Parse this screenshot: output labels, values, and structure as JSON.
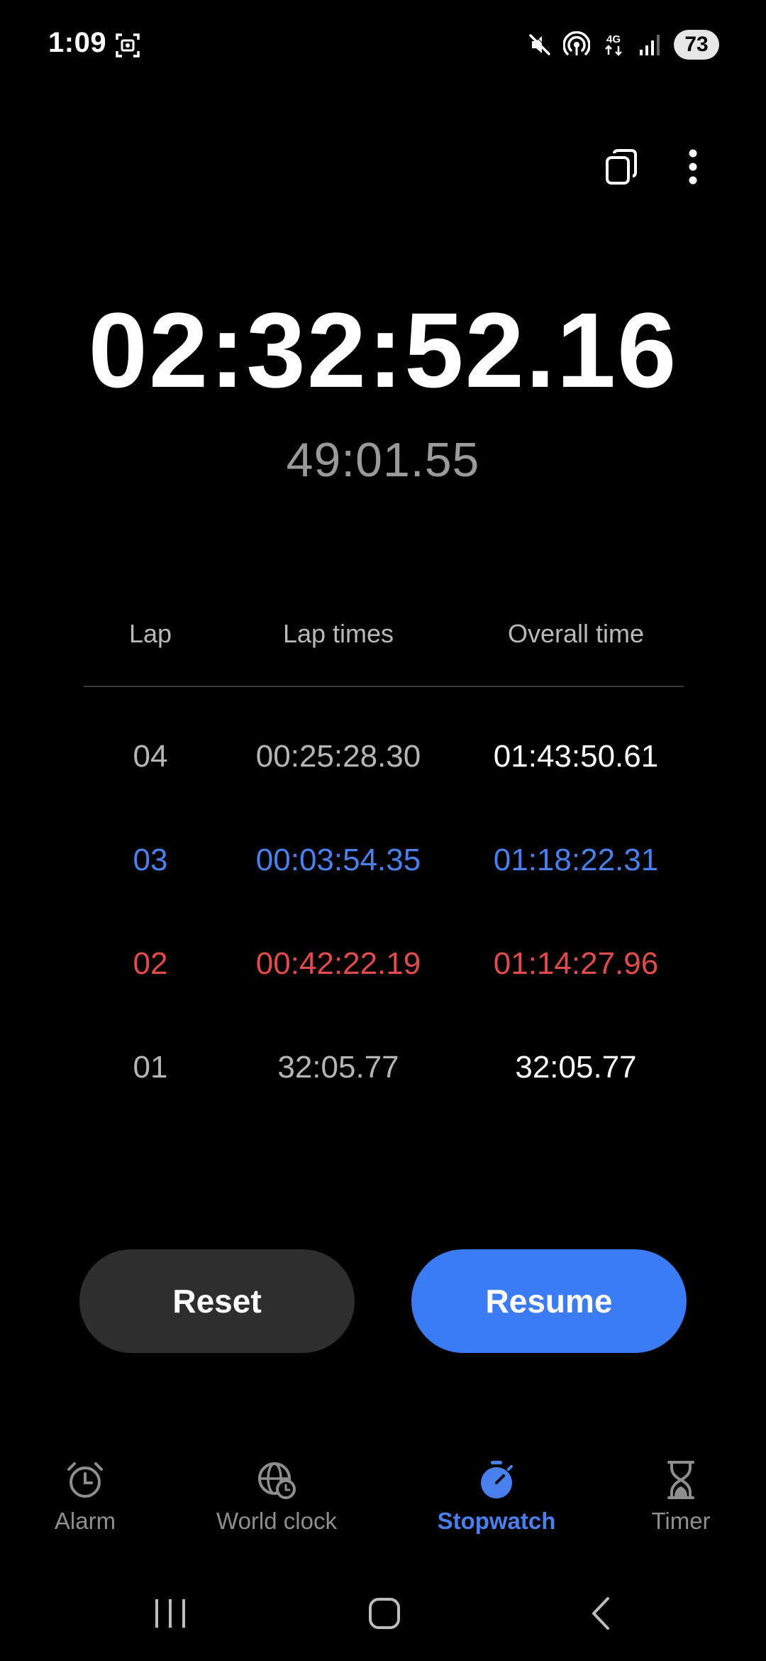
{
  "status_bar": {
    "time": "1:09",
    "battery_level": "73",
    "network_label": "4G"
  },
  "toolbar": {
    "pip_icon": "picture-in-picture-icon",
    "more_icon": "more-vert-icon"
  },
  "stopwatch": {
    "main_time": "02:32:52.16",
    "current_lap_time": "49:01.55"
  },
  "laps": {
    "headers": {
      "lap": "Lap",
      "lap_times": "Lap times",
      "overall_time": "Overall time"
    },
    "rows": [
      {
        "lap": "04",
        "lap_time": "00:25:28.30",
        "overall": "01:43:50.61",
        "status": "normal"
      },
      {
        "lap": "03",
        "lap_time": "00:03:54.35",
        "overall": "01:18:22.31",
        "status": "fastest"
      },
      {
        "lap": "02",
        "lap_time": "00:42:22.19",
        "overall": "01:14:27.96",
        "status": "slowest"
      },
      {
        "lap": "01",
        "lap_time": "32:05.77",
        "overall": "32:05.77",
        "status": "normal"
      }
    ]
  },
  "buttons": {
    "reset": "Reset",
    "resume": "Resume"
  },
  "bottom_nav": {
    "tabs": [
      {
        "label": "Alarm",
        "icon": "alarm-clock-icon",
        "active": false
      },
      {
        "label": "World clock",
        "icon": "globe-clock-icon",
        "active": false
      },
      {
        "label": "Stopwatch",
        "icon": "stopwatch-icon",
        "active": true
      },
      {
        "label": "Timer",
        "icon": "hourglass-icon",
        "active": false
      }
    ]
  },
  "colors": {
    "background": "#000000",
    "accent": "#3b7cf4",
    "fastest_lap": "#4a80ee",
    "slowest_lap": "#e14b4b",
    "reset_button": "#2e2e2e"
  }
}
